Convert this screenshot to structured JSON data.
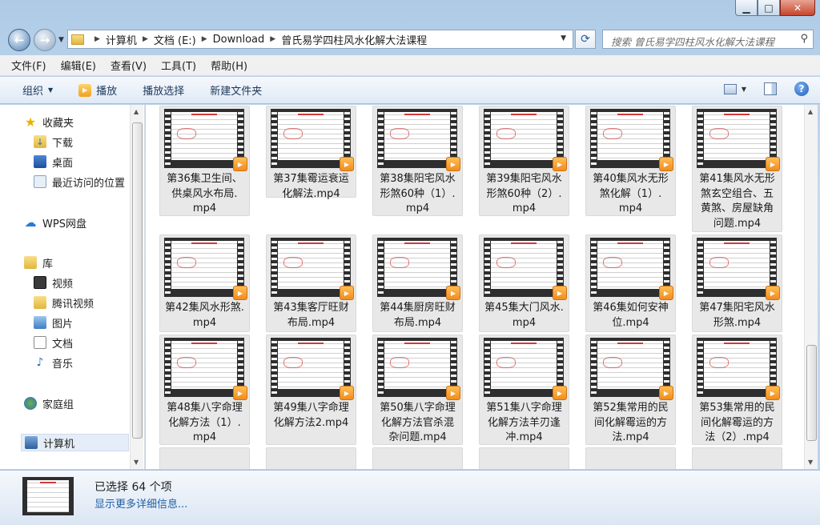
{
  "window": {
    "minimize": "▁",
    "maximize": "□",
    "close": "✕"
  },
  "address": {
    "crumbs": [
      "计算机",
      "文档 (E:)",
      "Download",
      "曾氏易学四柱风水化解大法课程"
    ],
    "search_placeholder": "搜索 曾氏易学四柱风水化解大法课程"
  },
  "menu": [
    "文件(F)",
    "编辑(E)",
    "查看(V)",
    "工具(T)",
    "帮助(H)"
  ],
  "toolbar": {
    "organize": "组织",
    "play": "播放",
    "play_selection": "播放选择",
    "new_folder": "新建文件夹"
  },
  "nav": {
    "favorites": "收藏夹",
    "downloads": "下载",
    "desktop": "桌面",
    "recent": "最近访问的位置",
    "wps": "WPS网盘",
    "libraries": "库",
    "videos": "视频",
    "tencent_video": "腾讯视频",
    "pictures": "图片",
    "documents": "文档",
    "music": "音乐",
    "homegroup": "家庭组",
    "computer": "计算机"
  },
  "files": [
    {
      "l1": "第36集卫生间、",
      "l2": "供桌风水布局.",
      "l3": "mp4",
      "l4": ""
    },
    {
      "l1": "第37集霉运衰运",
      "l2": "化解法.mp4",
      "l3": "",
      "l4": ""
    },
    {
      "l1": "第38集阳宅风水",
      "l2": "形煞60种（1）.",
      "l3": "mp4",
      "l4": ""
    },
    {
      "l1": "第39集阳宅风水",
      "l2": "形煞60种（2）.",
      "l3": "mp4",
      "l4": ""
    },
    {
      "l1": "第40集风水无形",
      "l2": "煞化解（1）.",
      "l3": "mp4",
      "l4": ""
    },
    {
      "l1": "第41集风水无形",
      "l2": "煞玄空组合、五",
      "l3": "黄煞、房屋缺角",
      "l4": "问题.mp4"
    },
    {
      "l1": "第42集风水形煞.",
      "l2": "mp4",
      "l3": "",
      "l4": ""
    },
    {
      "l1": "第43集客厅旺财",
      "l2": "布局.mp4",
      "l3": "",
      "l4": ""
    },
    {
      "l1": "第44集厨房旺财",
      "l2": "布局.mp4",
      "l3": "",
      "l4": ""
    },
    {
      "l1": "第45集大门风水.",
      "l2": "mp4",
      "l3": "",
      "l4": ""
    },
    {
      "l1": "第46集如何安神",
      "l2": "位.mp4",
      "l3": "",
      "l4": ""
    },
    {
      "l1": "第47集阳宅风水",
      "l2": "形煞.mp4",
      "l3": "",
      "l4": ""
    },
    {
      "l1": "第48集八字命理",
      "l2": "化解方法（1）.",
      "l3": "mp4",
      "l4": ""
    },
    {
      "l1": "第49集八字命理",
      "l2": "化解方法2.mp4",
      "l3": "",
      "l4": ""
    },
    {
      "l1": "第50集八字命理",
      "l2": "化解方法官杀混",
      "l3": "杂问题.mp4",
      "l4": ""
    },
    {
      "l1": "第51集八字命理",
      "l2": "化解方法羊刃逢",
      "l3": "冲.mp4",
      "l4": ""
    },
    {
      "l1": "第52集常用的民",
      "l2": "间化解霉运的方",
      "l3": "法.mp4",
      "l4": ""
    },
    {
      "l1": "第53集常用的民",
      "l2": "间化解霉运的方",
      "l3": "法（2）.mp4",
      "l4": ""
    }
  ],
  "details": {
    "selected": "已选择 64 个项",
    "more": "显示更多详细信息..."
  }
}
